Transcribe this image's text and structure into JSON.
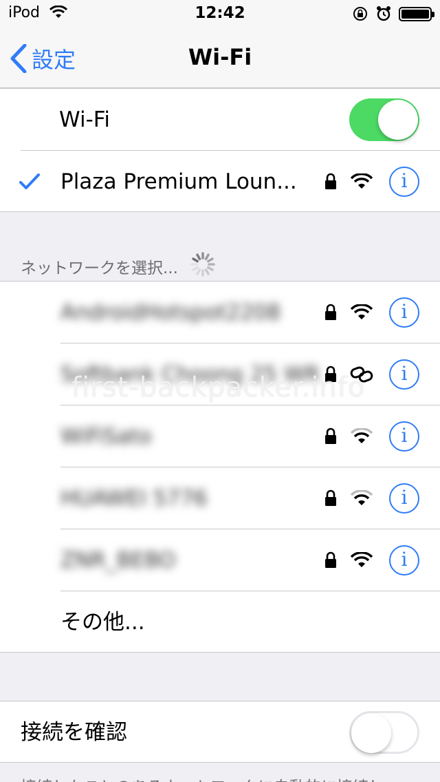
{
  "status_bar": {
    "carrier": "iPod",
    "time": "12:42",
    "icons": [
      "wifi-icon",
      "rotation-lock-icon",
      "alarm-icon",
      "battery-icon"
    ]
  },
  "nav": {
    "back_label": "設定",
    "title": "Wi-Fi"
  },
  "wifi_toggle": {
    "label": "Wi-Fi",
    "on": true
  },
  "connected_network": {
    "name": "Plaza Premium Loun...",
    "secured": true,
    "signal": 3
  },
  "network_section_header": "ネットワークを選択...",
  "networks": [
    {
      "name": "AndroidHotspot2208",
      "icon": "wifi-icon",
      "secured": true
    },
    {
      "name": "Softbank Choong 25 WR",
      "icon": "link-icon",
      "secured": true
    },
    {
      "name": "WiFiSato",
      "icon": "wifi-icon",
      "secured": true
    },
    {
      "name": "HUAWEI 5776",
      "icon": "wifi-icon",
      "secured": true
    },
    {
      "name": "ZNR_BEBO",
      "icon": "wifi-icon",
      "secured": true
    }
  ],
  "other_label": "その他...",
  "ask_to_join": {
    "label": "接続を確認",
    "on": false
  },
  "footer_note": "接続したことのあるネットワークに自動的に接続し",
  "watermark": "first-backpacker.info",
  "colors": {
    "accent": "#2f7cf6",
    "toggle_on": "#4cd964",
    "background": "#efeff4"
  }
}
